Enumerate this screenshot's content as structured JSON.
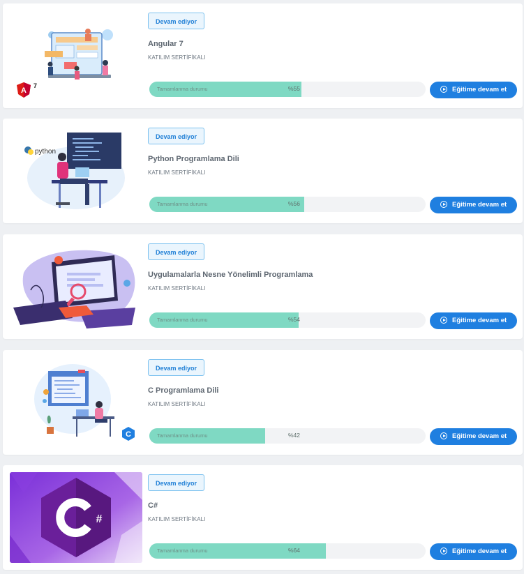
{
  "courses": [
    {
      "status": "Devam ediyor",
      "title": "Angular 7",
      "subtitle": "KATILIM SERTİFİKALI",
      "progress_label": "Tamamlanma durumu",
      "progress_text": "%55",
      "progress": 0.55,
      "cta": "Eğitime devam et",
      "logo_text": "7",
      "accent": "#dd1b16"
    },
    {
      "status": "Devam ediyor",
      "title": "Python Programlama Dili",
      "subtitle": "KATILIM SERTİFİKALI",
      "progress_label": "Tamamlanma durumu",
      "progress_text": "%56",
      "progress": 0.56,
      "cta": "Eğitime devam et",
      "logo_text": "python",
      "accent": "#3776ab"
    },
    {
      "status": "Devam ediyor",
      "title": "Uygulamalarla Nesne Yönelimli Programlama",
      "subtitle": "KATILIM SERTİFİKALI",
      "progress_label": "Tamamlanma durumu",
      "progress_text": "%54",
      "progress": 0.54,
      "cta": "Eğitime devam et",
      "accent": "#6e5ce6"
    },
    {
      "status": "Devam ediyor",
      "title": "C Programlama Dili",
      "subtitle": "KATILIM SERTİFİKALI",
      "progress_label": "Tamamlanma durumu",
      "progress_text": "%42",
      "progress": 0.42,
      "cta": "Eğitime devam et",
      "accent": "#1f7fe0"
    },
    {
      "status": "Devam ediyor",
      "title": "C#",
      "subtitle": "KATILIM SERTİFİKALI",
      "progress_label": "Tamamlanma durumu",
      "progress_text": "%64",
      "progress": 0.64,
      "cta": "Eğitime devam et",
      "accent": "#8a3fd1"
    }
  ],
  "colors": {
    "progress_fill": "#7fd9c3",
    "progress_track": "#f2f3f5",
    "button": "#1f7fe0",
    "badge_border": "#7cc1ef",
    "badge_text": "#1f7fe0"
  },
  "icons": {
    "cta": "play-circle-icon"
  }
}
